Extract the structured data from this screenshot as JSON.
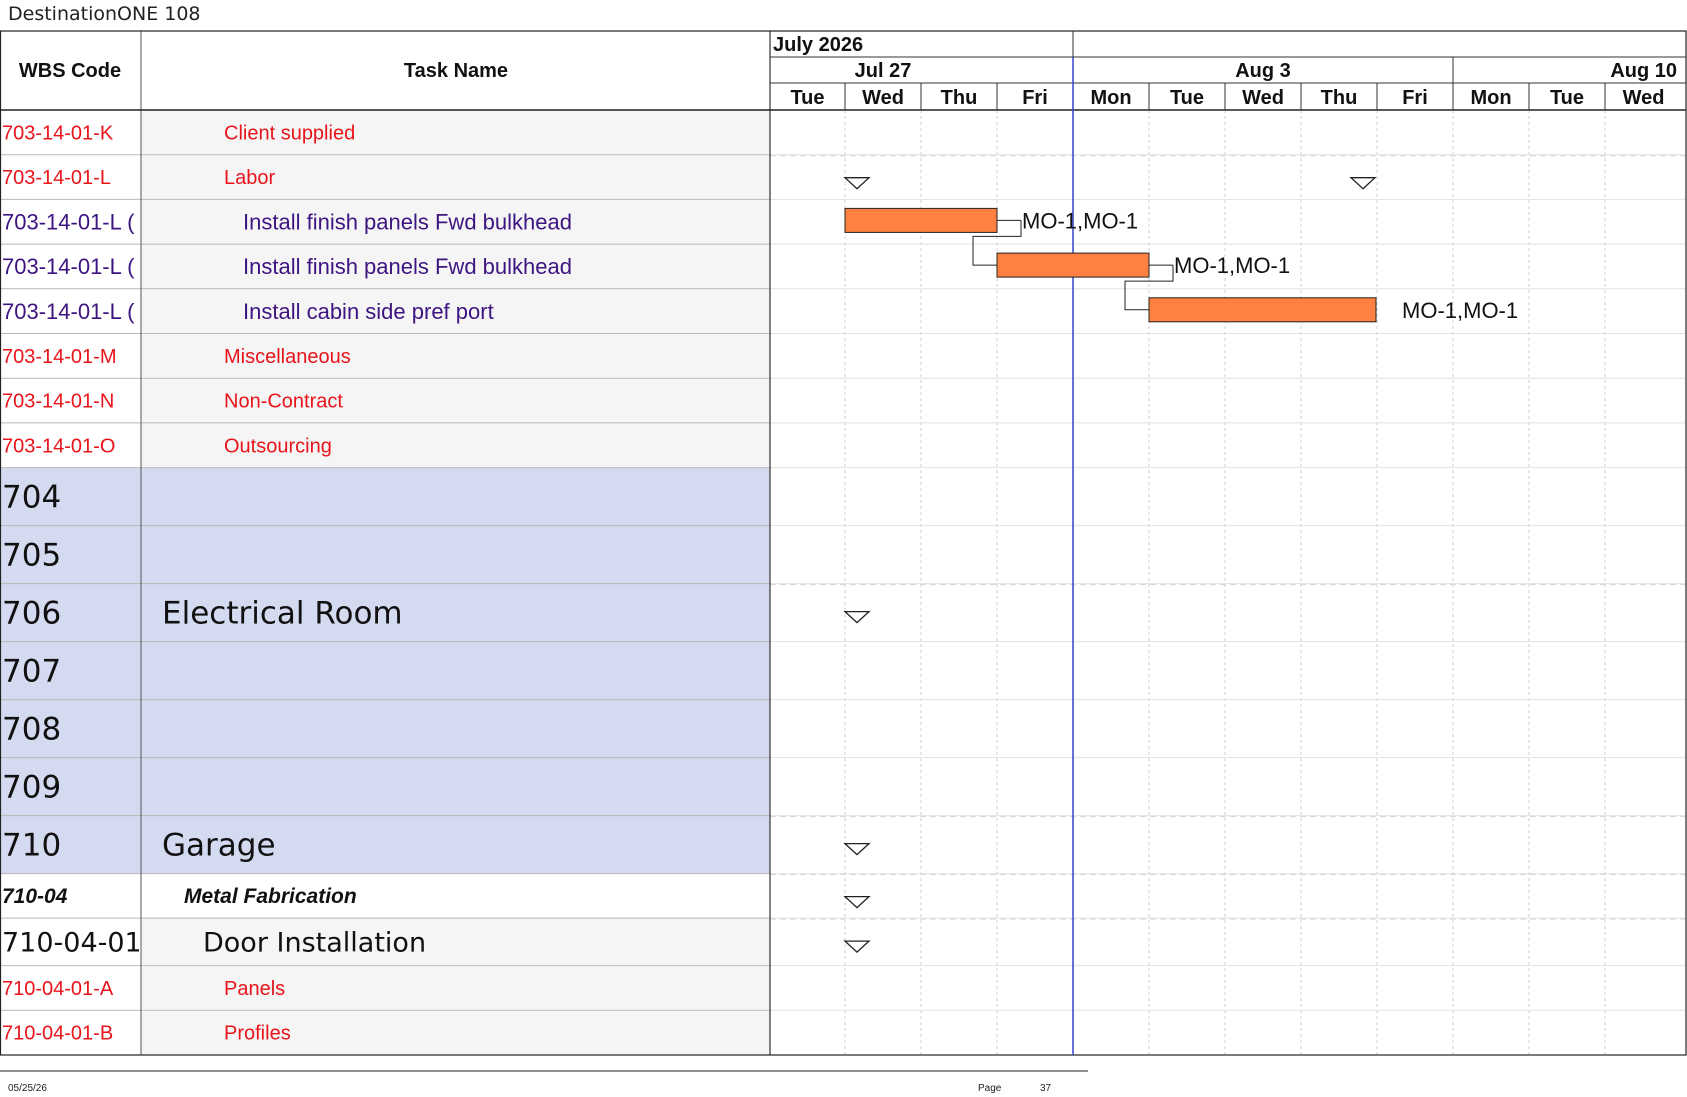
{
  "window_title": "DestinationONE 108",
  "table": {
    "col_wbs_header": "WBS Code",
    "col_task_header": "Task Name"
  },
  "timescale": {
    "month_label": "July 2026",
    "weeks": [
      "Jul 27",
      "Aug 3",
      "Aug 10"
    ],
    "days": [
      "Tue",
      "Wed",
      "Thu",
      "Fri",
      "Mon",
      "Tue",
      "Wed",
      "Thu",
      "Fri",
      "Mon",
      "Tue",
      "Wed"
    ],
    "current_date_marker_after_day": "Fri"
  },
  "rows": [
    {
      "wbs": "703-14-01-K",
      "task": "Client supplied",
      "style": "red"
    },
    {
      "wbs": "703-14-01-L",
      "task": "Labor",
      "style": "red",
      "summary_start_day": 1,
      "summary_end_day": 7
    },
    {
      "wbs": "703-14-01-L (",
      "task": "Install finish panels Fwd bulkhead",
      "style": "purple",
      "bar_start_day": 1,
      "bar_end_day": 3,
      "resources": "MO-1,MO-1"
    },
    {
      "wbs": "703-14-01-L (",
      "task": "Install finish panels Fwd bulkhead",
      "style": "purple",
      "bar_start_day": 3,
      "bar_end_day": 5,
      "resources": "MO-1,MO-1"
    },
    {
      "wbs": "703-14-01-L (",
      "task": "Install cabin side pref port",
      "style": "purple",
      "bar_start_day": 5,
      "bar_end_day": 8,
      "resources": "MO-1,MO-1"
    },
    {
      "wbs": "703-14-01-M",
      "task": "Miscellaneous",
      "style": "red"
    },
    {
      "wbs": "703-14-01-N",
      "task": "Non-Contract",
      "style": "red"
    },
    {
      "wbs": "703-14-01-O",
      "task": "Outsourcing",
      "style": "red"
    },
    {
      "wbs": "704",
      "task": "",
      "style": "level1"
    },
    {
      "wbs": "705",
      "task": "",
      "style": "level1"
    },
    {
      "wbs": "706",
      "task": "Electrical Room",
      "style": "level1",
      "summary_start_day": 1
    },
    {
      "wbs": "707",
      "task": "",
      "style": "level1"
    },
    {
      "wbs": "708",
      "task": "",
      "style": "level1"
    },
    {
      "wbs": "709",
      "task": "",
      "style": "level1"
    },
    {
      "wbs": "710",
      "task": "Garage",
      "style": "level1",
      "summary_start_day": 1
    },
    {
      "wbs": "710-04",
      "task": "Metal Fabrication",
      "style": "level2",
      "summary_start_day": 1
    },
    {
      "wbs": "710-04-01",
      "task": "Door Installation",
      "style": "level3",
      "summary_start_day": 1
    },
    {
      "wbs": "710-04-01-A",
      "task": "Panels",
      "style": "red"
    },
    {
      "wbs": "710-04-01-B",
      "task": "Profiles",
      "style": "red"
    }
  ],
  "footer": {
    "date": "05/25/26",
    "page_label": "Page",
    "page_number": "37"
  },
  "colors": {
    "red_text": "#e8141a",
    "purple_text": "#3d1480",
    "level1_fill": "#d4daf0",
    "task_bar": "#ff8040",
    "current_date_line": "#3344cc"
  }
}
